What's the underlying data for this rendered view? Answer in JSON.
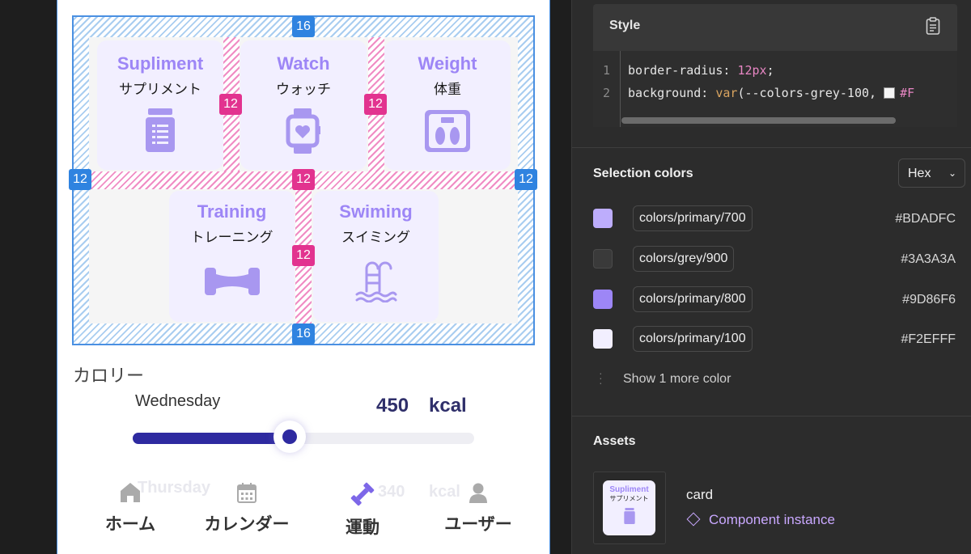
{
  "canvas": {
    "cards": [
      {
        "en": "Supliment",
        "jp": "サプリメント",
        "icon": "supplement-bottle-icon"
      },
      {
        "en": "Watch",
        "jp": "ウォッチ",
        "icon": "smartwatch-icon"
      },
      {
        "en": "Weight",
        "jp": "体重",
        "icon": "scale-icon"
      },
      {
        "en": "Training",
        "jp": "トレーニング",
        "icon": "dumbbell-icon"
      },
      {
        "en": "Swiming",
        "jp": "スイミング",
        "icon": "pool-ladder-icon"
      }
    ],
    "spacing": {
      "padding_top": "16",
      "padding_bottom": "16",
      "padding_left": "12",
      "padding_right": "12",
      "gap_col_1": "12",
      "gap_col_2": "12",
      "gap_row": "12",
      "gap_col_bottom": "12"
    },
    "calorie": {
      "title": "カロリー",
      "day": "Wednesday",
      "value": "450",
      "unit": "kcal",
      "slider_fraction": 0.46
    },
    "ghost_row": {
      "day": "Thursday",
      "value": "340",
      "unit": "kcal"
    },
    "nav": [
      {
        "label": "ホーム",
        "icon": "home-icon"
      },
      {
        "label": "カレンダー",
        "icon": "calendar-icon"
      },
      {
        "label": "運動",
        "icon": "dumbbell-icon",
        "active": true
      },
      {
        "label": "ユーザー",
        "icon": "user-icon"
      }
    ]
  },
  "panel": {
    "style": {
      "title": "Style",
      "line_numbers": [
        "1",
        "2"
      ],
      "line1": {
        "prop": "border-radius: ",
        "value": "12px",
        "end": ";"
      },
      "line2": {
        "prop": "background: ",
        "fn": "var",
        "open": "(",
        "var": "--colors-grey-100",
        "sep": ", ",
        "hex": "#F"
      }
    },
    "selection_colors": {
      "title": "Selection colors",
      "format": "Hex",
      "items": [
        {
          "token": "colors/primary/700",
          "hex": "#BDADFC",
          "color": "#BDADFC"
        },
        {
          "token": "colors/grey/900",
          "hex": "#3A3A3A",
          "color": "#3A3A3A"
        },
        {
          "token": "colors/primary/800",
          "hex": "#9D86F6",
          "color": "#9D86F6"
        },
        {
          "token": "colors/primary/100",
          "hex": "#F2EFFF",
          "color": "#F2EFFF"
        }
      ],
      "more": "Show 1 more color"
    },
    "assets": {
      "title": "Assets",
      "thumb_en": "Supliment",
      "thumb_jp": "サプリメント",
      "name": "card",
      "type": "Component instance"
    }
  }
}
